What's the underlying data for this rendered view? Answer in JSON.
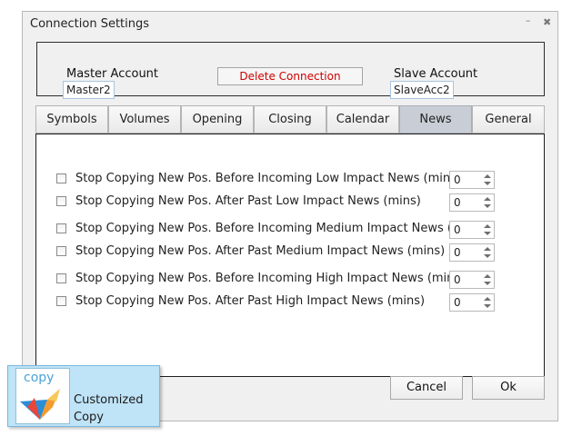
{
  "window": {
    "title": "Connection Settings",
    "minimize_glyph": "–",
    "close_glyph": "✖"
  },
  "accounts": {
    "master_label": "Master Account",
    "master_value": "Master2",
    "delete_label": "Delete Connection",
    "slave_label": "Slave Account",
    "slave_value": "SlaveAcc2"
  },
  "tabs": [
    {
      "label": "Symbols",
      "active": false
    },
    {
      "label": "Volumes",
      "active": false
    },
    {
      "label": "Opening",
      "active": false
    },
    {
      "label": "Closing",
      "active": false
    },
    {
      "label": "Calendar",
      "active": false
    },
    {
      "label": "News",
      "active": true
    },
    {
      "label": "General",
      "active": false
    }
  ],
  "news_settings": [
    {
      "label": "Stop Copying New Pos. Before Incoming Low Impact News (mins)",
      "checked": false,
      "value": "0"
    },
    {
      "label": "Stop Copying New Pos. After Past Low Impact News (mins)",
      "checked": false,
      "value": "0"
    },
    {
      "label": "Stop Copying New Pos. Before Incoming Medium Impact News (mins)",
      "checked": false,
      "value": "0"
    },
    {
      "label": "Stop Copying New Pos. After Past Medium Impact News (mins)",
      "checked": false,
      "value": "0"
    },
    {
      "label": "Stop Copying New Pos. Before Incoming High Impact News (mins)",
      "checked": false,
      "value": "0"
    },
    {
      "label": "Stop Copying New Pos. After Past High Impact News (mins)",
      "checked": false,
      "value": "0"
    }
  ],
  "footer": {
    "cancel_label": "Cancel",
    "ok_label": "Ok"
  },
  "badge": {
    "logo_text": "copy",
    "line1": "Customized",
    "line2": "Copy"
  },
  "colors": {
    "delete_text": "#d00000",
    "active_tab": "#c9ced6",
    "badge_bg": "#bfe3f7"
  }
}
